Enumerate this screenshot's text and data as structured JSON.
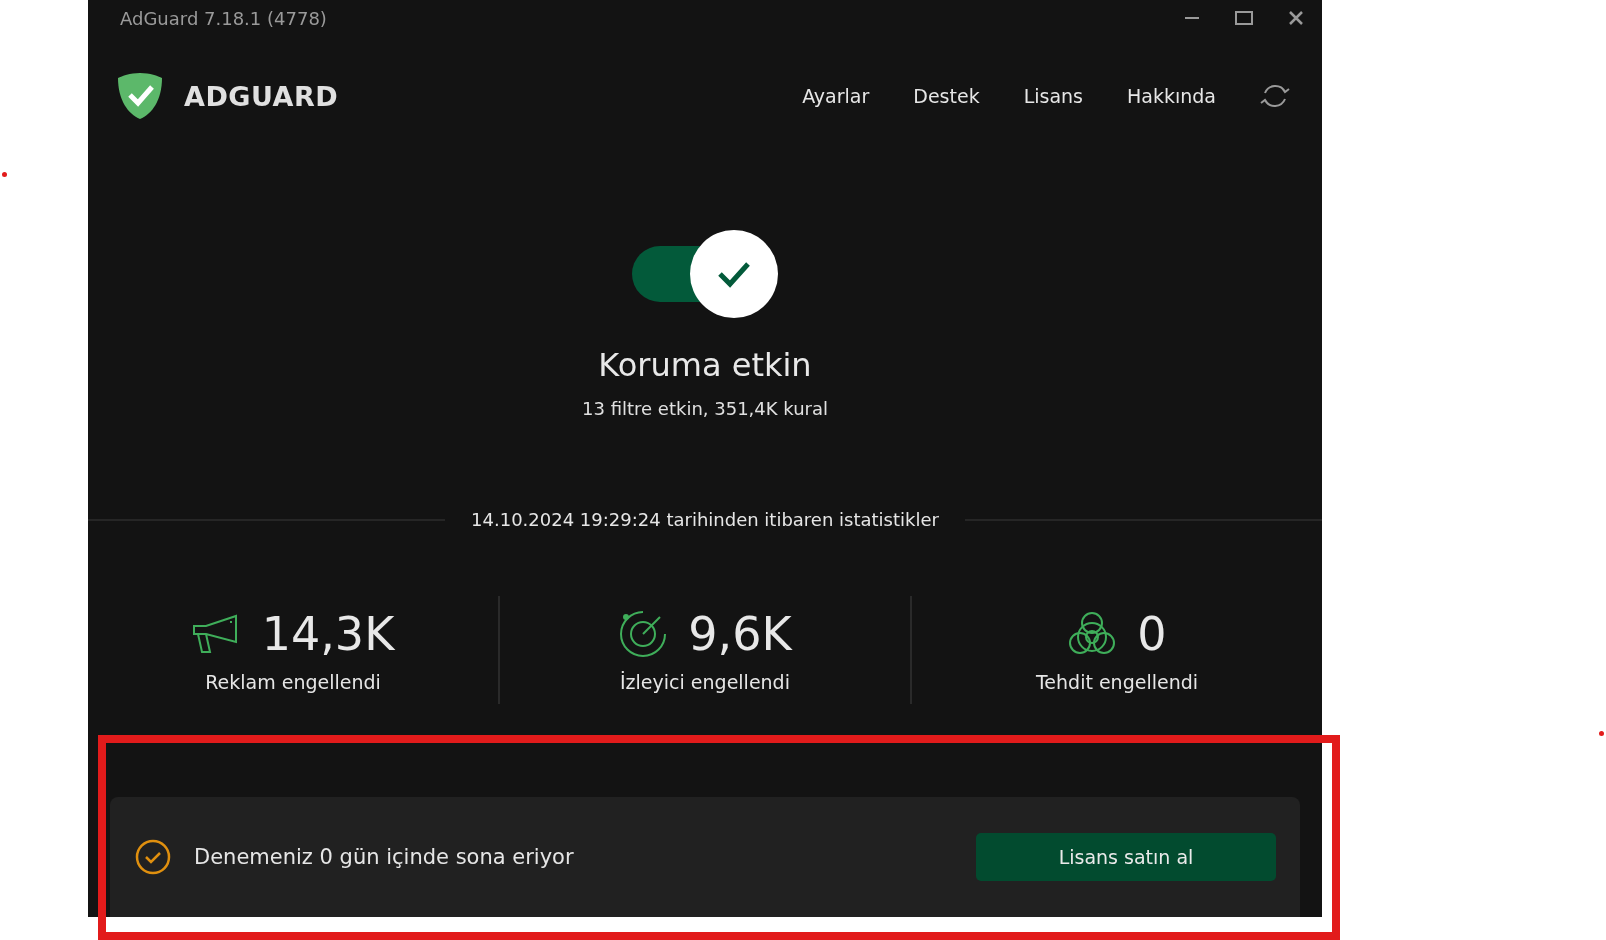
{
  "window": {
    "title": "AdGuard 7.18.1 (4778)"
  },
  "brand": "ADGUARD",
  "nav": [
    {
      "label": "Ayarlar"
    },
    {
      "label": "Destek"
    },
    {
      "label": "Lisans"
    },
    {
      "label": "Hakkında"
    }
  ],
  "protection": {
    "on": true,
    "title": "Koruma etkin",
    "subtitle": "13 filtre etkin, 351,4K kural"
  },
  "stats_since": "14.10.2024 19:29:24 tarihinden itibaren istatistikler",
  "stats": [
    {
      "kind": "ads",
      "value": "14,3K",
      "label": "Reklam engellendi"
    },
    {
      "kind": "trackers",
      "value": "9,6K",
      "label": "İzleyici engellendi"
    },
    {
      "kind": "threats",
      "value": "0",
      "label": "Tehdit engellendi"
    }
  ],
  "trial": {
    "message": "Denemeniz 0 gün içinde sona eriyor",
    "button": "Lisans satın al"
  }
}
